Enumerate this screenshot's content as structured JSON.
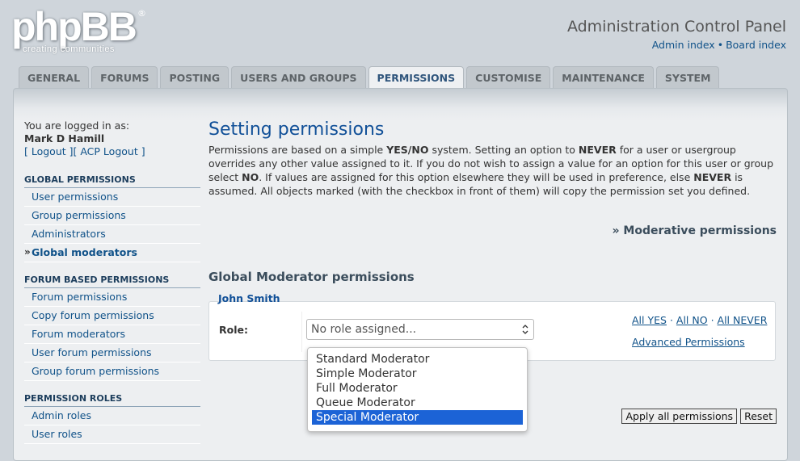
{
  "logo": {
    "main": "phpBB",
    "registered": "®",
    "tagline": "creating communities"
  },
  "header": {
    "title": "Administration Control Panel",
    "links": [
      "Admin index",
      "Board index"
    ],
    "separator": "•"
  },
  "tabs": [
    {
      "label": "GENERAL"
    },
    {
      "label": "FORUMS"
    },
    {
      "label": "POSTING"
    },
    {
      "label": "USERS AND GROUPS"
    },
    {
      "label": "PERMISSIONS",
      "active": true
    },
    {
      "label": "CUSTOMISE"
    },
    {
      "label": "MAINTENANCE"
    },
    {
      "label": "SYSTEM"
    }
  ],
  "sidebar": {
    "login_label": "You are logged in as:",
    "username": "Mark D Hamill",
    "logout_link": "[ Logout ]",
    "acp_logout_link": "[ ACP Logout ]",
    "sections": [
      {
        "title": "GLOBAL PERMISSIONS",
        "items": [
          "User permissions",
          "Group permissions",
          "Administrators",
          "Global moderators"
        ]
      },
      {
        "title": "FORUM BASED PERMISSIONS",
        "items": [
          "Forum permissions",
          "Copy forum permissions",
          "Forum moderators",
          "User forum permissions",
          "Group forum permissions"
        ]
      },
      {
        "title": "PERMISSION ROLES",
        "items": [
          "Admin roles",
          "User roles"
        ]
      }
    ],
    "current_marker": "»"
  },
  "content": {
    "title": "Setting permissions",
    "intro_parts": [
      {
        "t": "Permissions are based on a simple "
      },
      {
        "t": "YES/NO",
        "b": true
      },
      {
        "t": " system. Setting an option to "
      },
      {
        "t": "NEVER",
        "b": true
      },
      {
        "t": " for a user or usergroup overrides any other value assigned to it. If you do not wish to assign a value for an option for this user or group select "
      },
      {
        "t": "NO",
        "b": true
      },
      {
        "t": ". If values are assigned for this option elsewhere they will be used in preference, else "
      },
      {
        "t": "NEVER",
        "b": true
      },
      {
        "t": " is assumed. All objects marked (with the checkbox in front of them) will copy the permission set you defined."
      }
    ],
    "moderative_link": "» Moderative permissions",
    "subtitle": "Global Moderator permissions",
    "fieldset_legend": "John Smith",
    "role_label": "Role:",
    "role_select": {
      "value": "No role assigned..."
    },
    "all_yes": "All YES",
    "all_no": "All NO",
    "all_never": "All NEVER",
    "link_separator": "·",
    "advanced_link": "Advanced Permissions",
    "dropdown_options": [
      "Standard Moderator",
      "Simple Moderator",
      "Full Moderator",
      "Queue Moderator",
      "Special Moderator"
    ],
    "dropdown_selected": "Special Moderator",
    "apply_button": "Apply all permissions",
    "reset_button": "Reset"
  },
  "colors": {
    "link": "#105289",
    "title": "#115098",
    "selected_option": "#1c63d6"
  },
  "icons": {
    "select_arrow": "chevron-updown-icon"
  }
}
